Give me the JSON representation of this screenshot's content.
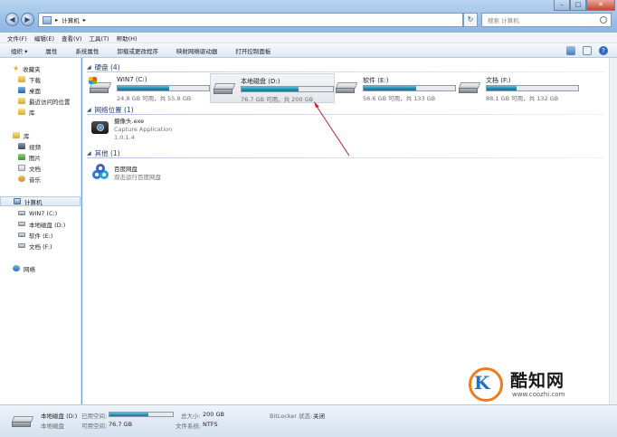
{
  "address": {
    "crumbs": [
      "计算机"
    ]
  },
  "search": {
    "placeholder": "搜索 计算机"
  },
  "menu": [
    "文件(F)",
    "编辑(E)",
    "查看(V)",
    "工具(T)",
    "帮助(H)"
  ],
  "toolbar": [
    "组织 ▾",
    "属性",
    "系统属性",
    "卸载或更改程序",
    "映射网络驱动器",
    "打开控制面板"
  ],
  "nav": {
    "favorites": "收藏夹",
    "fav_items": [
      "下载",
      "桌面",
      "最近访问的位置"
    ],
    "library_items": [
      "库",
      "视频",
      "图片",
      "文档",
      "音乐"
    ],
    "computer": "计算机",
    "computer_items": [
      "WIN7 (C:)",
      "本地磁盘 (D:)",
      "软件 (E:)",
      "文档 (F:)"
    ],
    "network": "网络"
  },
  "groups": {
    "hdd": "硬盘 (4)",
    "netloc": "网络位置 (1)",
    "other": "其他 (1)"
  },
  "drives": [
    {
      "name": "WIN7 (C:)",
      "space": "24.8 GB 可用，共 55.8 GB",
      "used_fraction": 0.56
    },
    {
      "name": "本地磁盘 (D:)",
      "space": "76.7 GB 可用，共 200 GB",
      "used_fraction": 0.62
    },
    {
      "name": "软件 (E:)",
      "space": "56.6 GB 可用，共 133 GB",
      "used_fraction": 0.57
    },
    {
      "name": "文档 (F:)",
      "space": "88.1 GB 可用，共 132 GB",
      "used_fraction": 0.33
    }
  ],
  "netapp": {
    "name": "摄像头.exe",
    "desc": "Capture Application",
    "version": "1.0.1.4"
  },
  "otherapp": {
    "name": "百度网盘",
    "desc": "双击运行百度网盘"
  },
  "details": {
    "name": "本地磁盘 (D:)",
    "type": "本地磁盘",
    "used_label": "已用空间:",
    "free_label": "可用空间:",
    "free_value": "76.7 GB",
    "total_label": "总大小:",
    "total_value": "200 GB",
    "fs_label": "文件系统:",
    "fs_value": "NTFS",
    "bitlocker_label": "BitLocker 状态:",
    "bitlocker_value": "关闭",
    "used_fraction": 0.62
  },
  "watermark": {
    "brand": "酷知网",
    "url": "www.coozhi.com",
    "mark": "K"
  }
}
